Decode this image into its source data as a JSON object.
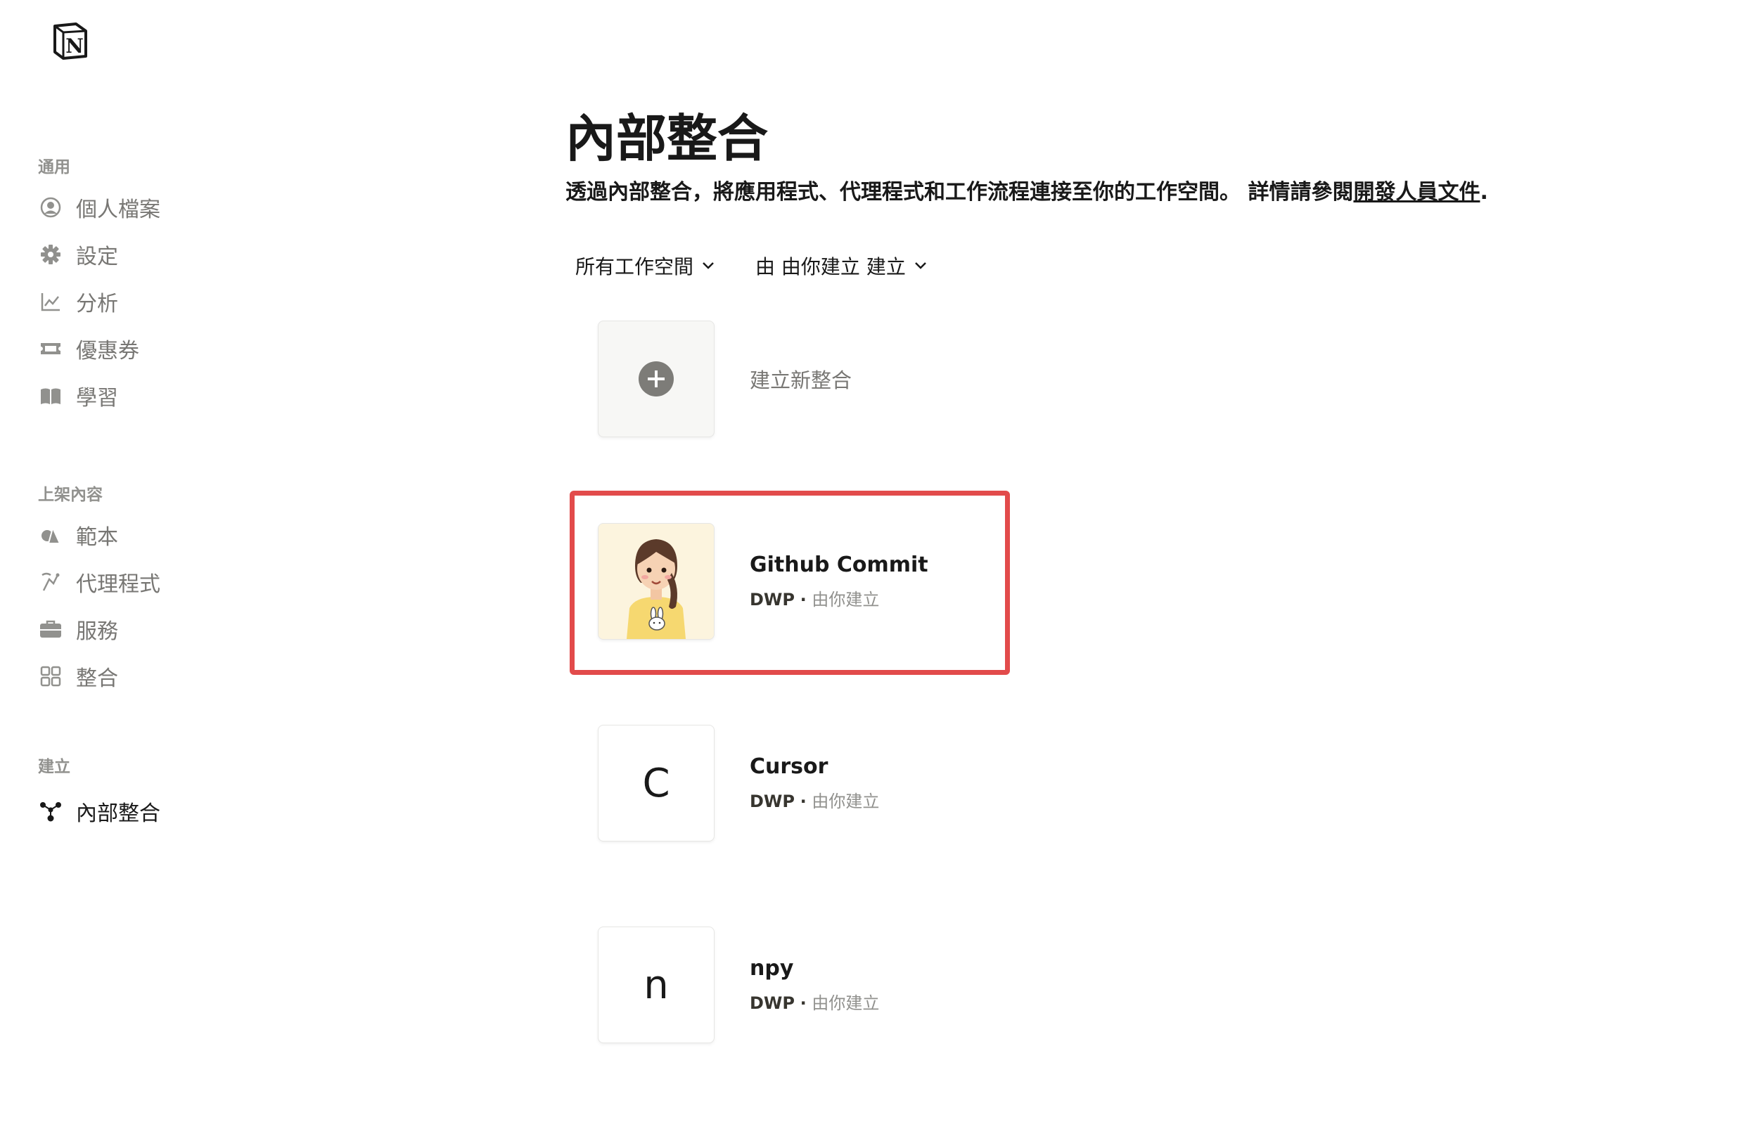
{
  "app": {
    "logo_icon": "notion-logo-icon"
  },
  "sidebar": {
    "section_general": "通用",
    "general_items": [
      {
        "label": "個人檔案",
        "icon": "profile-icon"
      },
      {
        "label": "設定",
        "icon": "gear-icon"
      },
      {
        "label": "分析",
        "icon": "chart-icon"
      },
      {
        "label": "優惠券",
        "icon": "ticket-icon"
      },
      {
        "label": "學習",
        "icon": "book-icon"
      }
    ],
    "section_listed": "上架內容",
    "listed_items": [
      {
        "label": "範本",
        "icon": "shapes-icon"
      },
      {
        "label": "代理程式",
        "icon": "agent-icon"
      },
      {
        "label": "服務",
        "icon": "briefcase-icon"
      },
      {
        "label": "整合",
        "icon": "grid-icon"
      }
    ],
    "section_build": "建立",
    "build_items": [
      {
        "label": "內部整合",
        "icon": "nodes-icon",
        "active": true
      }
    ]
  },
  "main": {
    "title": "內部整合",
    "subtitle_text": "透過內部整合，將應用程式、代理程式和工作流程連接至你的工作空間。 詳情請參閱",
    "subtitle_link": "開發人員文件",
    "subtitle_end": ".",
    "filters": {
      "workspace": "所有工作空間",
      "creator": "由 由你建立 建立"
    },
    "new_integration_label": "建立新整合",
    "integrations": [
      {
        "name": "Github Commit",
        "workspace": "DWP",
        "separator": "·",
        "creator": "由你建立",
        "thumb": "avatar"
      },
      {
        "name": "Cursor",
        "workspace": "DWP",
        "separator": "·",
        "creator": "由你建立",
        "thumb": "C"
      },
      {
        "name": "npy",
        "workspace": "DWP",
        "separator": "·",
        "creator": "由你建立",
        "thumb": "n"
      }
    ]
  },
  "colors": {
    "highlight": "#e24b4b",
    "text": "#191919",
    "muted": "#91918e"
  }
}
